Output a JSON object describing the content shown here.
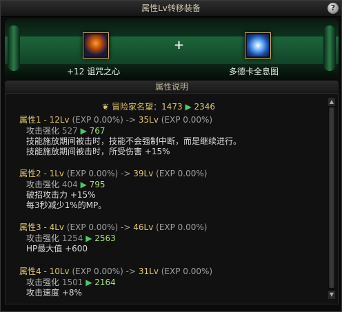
{
  "window": {
    "title": "属性Lv转移装备",
    "help": "?"
  },
  "banner": {
    "left_item": {
      "level": "+12",
      "name": "诅咒之心"
    },
    "plus": "+",
    "right_item": {
      "name": "多德卡全息图"
    }
  },
  "section": {
    "title": "属性说明"
  },
  "fame": {
    "label": "冒险家名望：",
    "from": "1473",
    "to": "2346"
  },
  "groups": [
    {
      "prop": "属性1 - 12Lv",
      "exp1": "(EXP 0.00%)",
      "arrow": "->",
      "to": "35Lv",
      "exp2": "(EXP 0.00%)",
      "stat_name": "攻击强化",
      "stat_from": "527",
      "stat_to": "767",
      "effects": [
        "技能施放期间被击时，技能不会强制中断，而是继续进行。",
        "技能施放期间被击时，所受伤害 +15%"
      ]
    },
    {
      "prop": "属性2 - 1Lv",
      "exp1": "(EXP 0.00%)",
      "arrow": "->",
      "to": "39Lv",
      "exp2": "(EXP 0.00%)",
      "stat_name": "攻击强化",
      "stat_from": "404",
      "stat_to": "795",
      "effects": [
        "破招攻击力 +15%",
        "每3秒减少1%的MP。"
      ]
    },
    {
      "prop": "属性3 - 4Lv",
      "exp1": "(EXP 0.00%)",
      "arrow": "->",
      "to": "46Lv",
      "exp2": "(EXP 0.00%)",
      "stat_name": "攻击强化",
      "stat_from": "1254",
      "stat_to": "2563",
      "effects": [
        "HP最大值 +600"
      ]
    },
    {
      "prop": "属性4 - 10Lv",
      "exp1": "(EXP 0.00%)",
      "arrow": "->",
      "to": "31Lv",
      "exp2": "(EXP 0.00%)",
      "stat_name": "攻击强化",
      "stat_from": "1501",
      "stat_to": "2164",
      "effects": [
        "攻击速度 +8%"
      ]
    }
  ]
}
